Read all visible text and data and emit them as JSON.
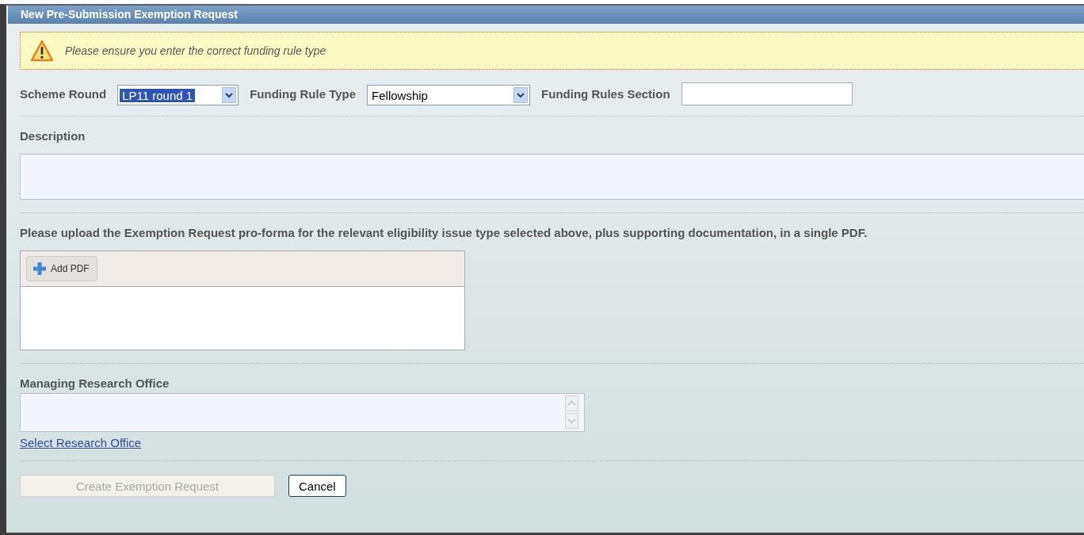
{
  "window": {
    "title": "New Pre-Submission Exemption Request"
  },
  "warning": {
    "text": "Please ensure you enter the correct funding rule type"
  },
  "criteria": [
    {
      "kind": "select",
      "label": "Scheme Round",
      "value": "LP11 round 1",
      "focused": true
    },
    {
      "kind": "select",
      "label": "Funding Rule Type",
      "value": "Fellowship",
      "focused": false
    },
    {
      "kind": "text",
      "label": "Funding Rules Section"
    }
  ],
  "description": {
    "label": "Description"
  },
  "upload": {
    "instructions": "Please upload the Exemption Request pro-forma for the relevant eligibility issue type selected above, plus supporting documentation, in a single PDF.",
    "add_button": "Add PDF"
  },
  "research_office": {
    "label": "Managing Research Office",
    "link": "Select Research Office"
  },
  "buttons": [
    {
      "label": "Create Exemption Request",
      "disabled": true
    },
    {
      "label": "Cancel",
      "disabled": false
    }
  ]
}
